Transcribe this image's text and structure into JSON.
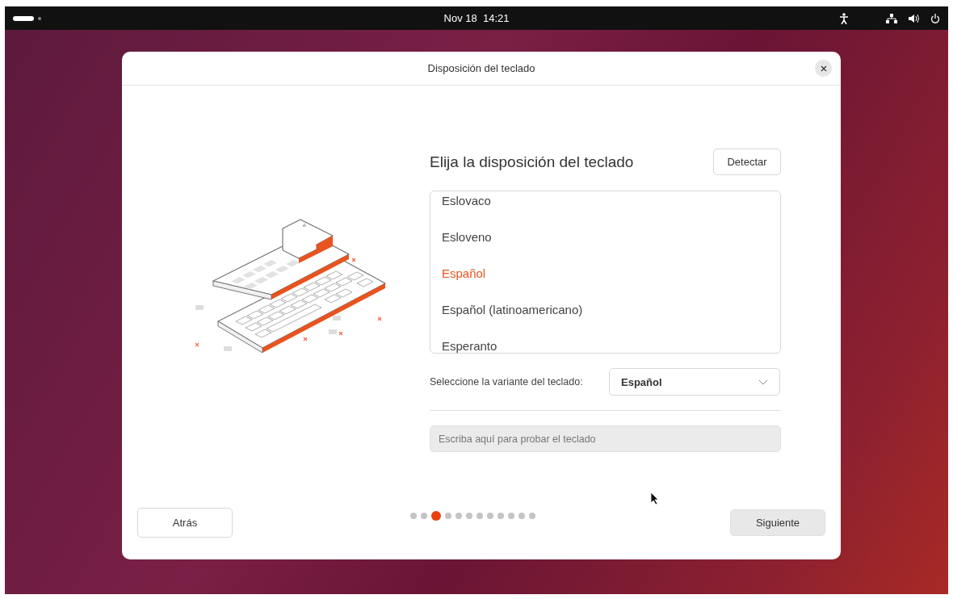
{
  "top_bar": {
    "clock": "Nov 18  14:21"
  },
  "dialog": {
    "title": "Disposición del teclado",
    "heading": "Elija la disposición del teclado",
    "detect_button": "Detectar",
    "layouts": [
      {
        "label": "Eslovaco",
        "selected": false
      },
      {
        "label": "Esloveno",
        "selected": false
      },
      {
        "label": "Español",
        "selected": true
      },
      {
        "label": "Español (latinoamericano)",
        "selected": false
      },
      {
        "label": "Esperanto",
        "selected": false
      }
    ],
    "variant": {
      "label": "Seleccione la variante del teclado:",
      "value": "Español"
    },
    "test_field": {
      "placeholder": "Escriba aquí para probar el teclado"
    },
    "back_button": "Atrás",
    "next_button": "Siguiente",
    "steps": [
      {
        "selected": false
      },
      {
        "selected": false
      },
      {
        "selected": true
      },
      {
        "selected": false
      },
      {
        "selected": false
      },
      {
        "selected": false
      },
      {
        "selected": false
      },
      {
        "selected": false
      },
      {
        "selected": false
      },
      {
        "selected": false
      },
      {
        "selected": false
      },
      {
        "selected": false
      }
    ]
  }
}
